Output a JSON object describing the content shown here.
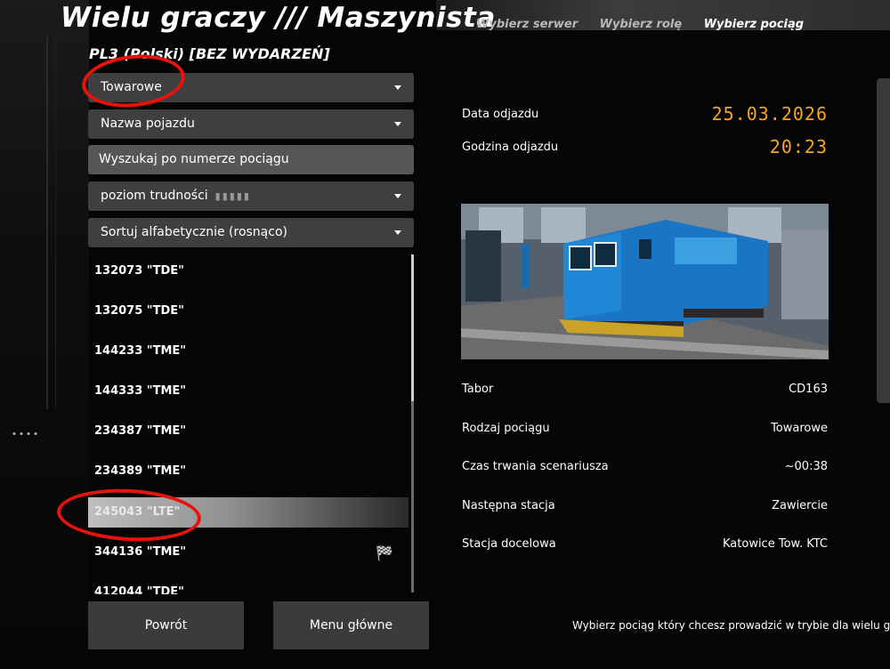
{
  "app": {
    "title": "Wielu graczy /// Maszynista"
  },
  "nav": {
    "items": [
      "Wybierz serwer",
      "Wybierz rolę",
      "Wybierz pociąg"
    ],
    "active_index": 2
  },
  "server": {
    "name": "PL3 (Polski) [BEZ WYDARZEŃ]"
  },
  "filters": {
    "train_type": {
      "value": "Towarowe"
    },
    "vehicle_name": {
      "value": "Nazwa pojazdu"
    },
    "search": {
      "placeholder": "Wyszukaj po numerze pociągu"
    },
    "difficulty": {
      "label": "poziom trudności",
      "dots": "▮▮▮▮▮"
    },
    "sort": {
      "value": "Sortuj alfabetycznie (rosnąco)"
    }
  },
  "train_list": {
    "items": [
      "132073 \"TDE\"",
      "132075 \"TDE\"",
      "144233 \"TME\"",
      "144333 \"TME\"",
      "234387 \"TME\"",
      "234389 \"TME\"",
      "245043 \"LTE\"",
      "344136 \"TME\"",
      "412044 \"TDE\""
    ],
    "selected_index": 6
  },
  "departure": {
    "date_label": "Data odjazdu",
    "date_value": "25.03.2026",
    "time_label": "Godzina odjazdu",
    "time_value": "20:23"
  },
  "details": [
    {
      "label": "Tabor",
      "value": "CD163"
    },
    {
      "label": "Rodzaj pociągu",
      "value": "Towarowe"
    },
    {
      "label": "Czas trwania scenariusza",
      "value": "~00:38"
    },
    {
      "label": "Następna stacja",
      "value": "Zawiercie"
    },
    {
      "label": "Stacja docelowa",
      "value": "Katowice Tow. KTC"
    }
  ],
  "buttons": {
    "back": "Powrót",
    "main_menu": "Menu główne"
  },
  "footer": {
    "hint": "Wybierz pociąg który chcesz prowadzić w trybie dla wielu graczy"
  },
  "icons": {
    "dropdown": "chevron-down-icon",
    "cursor": "checkered-flag-icon"
  },
  "colors": {
    "accent": "#f5a623",
    "annotation": "#e8120c",
    "panel": "#3f3f3f"
  }
}
